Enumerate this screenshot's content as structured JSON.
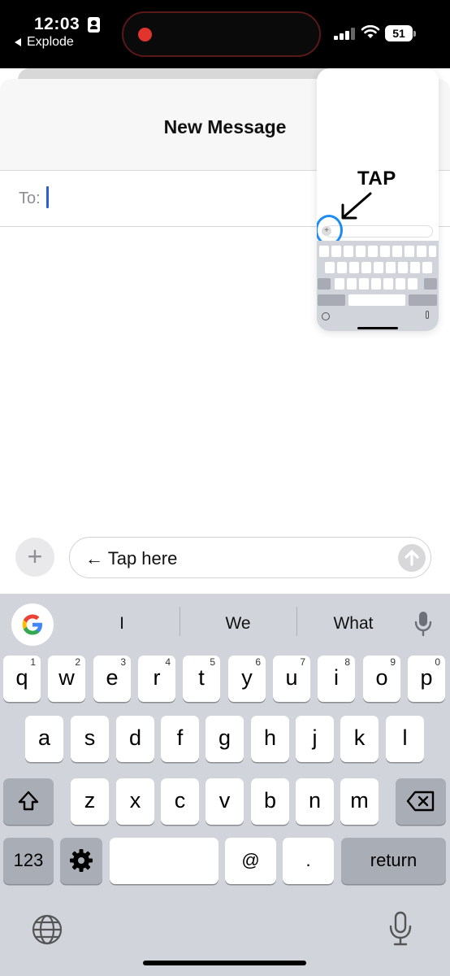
{
  "status_bar": {
    "time": "12:03",
    "back_app": "Explode",
    "battery": "51",
    "recording_color": "#e0342c"
  },
  "sheet": {
    "title": "New Message",
    "to_label": "To:"
  },
  "tutorial_overlay": {
    "tap_label": "TAP"
  },
  "compose": {
    "plus_label": "+",
    "message_text": "← Tap here",
    "send_icon": "arrow-up-icon"
  },
  "keyboard": {
    "suggestions": [
      "I",
      "We",
      "What"
    ],
    "row1": [
      {
        "letter": "q",
        "num": "1"
      },
      {
        "letter": "w",
        "num": "2"
      },
      {
        "letter": "e",
        "num": "3"
      },
      {
        "letter": "r",
        "num": "4"
      },
      {
        "letter": "t",
        "num": "5"
      },
      {
        "letter": "y",
        "num": "6"
      },
      {
        "letter": "u",
        "num": "7"
      },
      {
        "letter": "i",
        "num": "8"
      },
      {
        "letter": "o",
        "num": "9"
      },
      {
        "letter": "p",
        "num": "0"
      }
    ],
    "row2": [
      "a",
      "s",
      "d",
      "f",
      "g",
      "h",
      "j",
      "k",
      "l"
    ],
    "row3": [
      "z",
      "x",
      "c",
      "v",
      "b",
      "n",
      "m"
    ],
    "numbers_key": "123",
    "at_key": "@",
    "period_key": ".",
    "return_key": "return",
    "accent_blue": "#2e5bd8"
  }
}
